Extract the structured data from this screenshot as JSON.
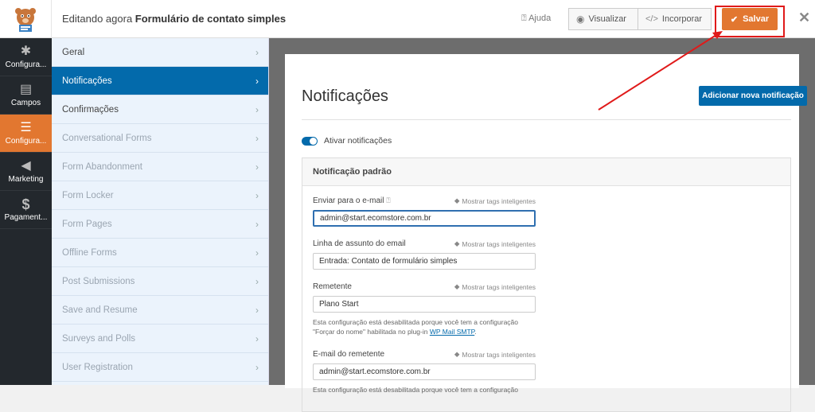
{
  "header": {
    "title_prefix": "Editando agora ",
    "title_form": "Formulário de contato simples",
    "help_label": "Ajuda",
    "preview_label": "Visualizar",
    "embed_label": "Incorporar",
    "save_label": "Salvar"
  },
  "leftnav": {
    "items": [
      {
        "label": "Configura...",
        "icon": "gear-icon"
      },
      {
        "label": "Campos",
        "icon": "fields-icon"
      },
      {
        "label": "Configura...",
        "icon": "sliders-icon",
        "active": true
      },
      {
        "label": "Marketing",
        "icon": "megaphone-icon"
      },
      {
        "label": "Pagament...",
        "icon": "dollar-icon"
      }
    ]
  },
  "subnav": {
    "items": [
      "Geral",
      "Notificações",
      "Confirmações",
      "Conversational Forms",
      "Form Abandonment",
      "Form Locker",
      "Form Pages",
      "Offline Forms",
      "Post Submissions",
      "Save and Resume",
      "Surveys and Polls",
      "User Registration"
    ],
    "active_index": 1
  },
  "panel": {
    "title": "Notificações",
    "add_button": "Adicionar nova notificação",
    "toggle_label": "Ativar notificações",
    "box_title": "Notificação padrão",
    "smart_tags": "Mostrar tags inteligentes",
    "fields": {
      "email_to": {
        "label": "Enviar para o e-mail",
        "value": "admin@start.ecomstore.com.br"
      },
      "subject": {
        "label": "Linha de assunto do email",
        "value": "Entrada: Contato de formulário simples"
      },
      "sender": {
        "label": "Remetente",
        "value": "Plano Start",
        "note_1": "Esta configuração está desabilitada porque você tem a configuração",
        "note_2": "\"Forçar do nome\" habilitada no plug-in ",
        "note_link": "WP Mail SMTP",
        "note_end": "."
      },
      "sender_email": {
        "label": "E-mail do remetente",
        "value": "admin@start.ecomstore.com.br",
        "note_1": "Esta configuração está desabilitada porque você tem a configuração"
      }
    }
  },
  "colors": {
    "accent": "#e27730",
    "primary": "#036aab",
    "highlight": "#e01a1a"
  }
}
